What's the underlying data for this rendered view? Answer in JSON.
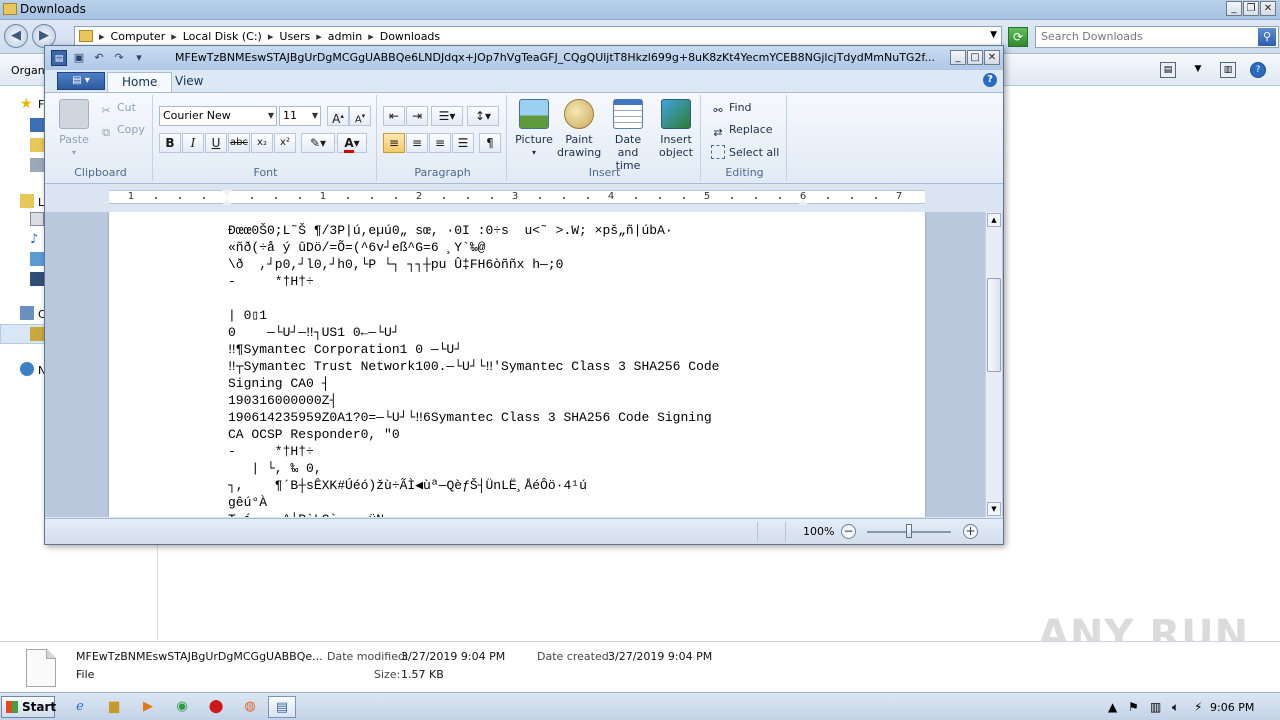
{
  "explorer": {
    "title": "Downloads",
    "breadcrumbs": [
      "Computer",
      "Local Disk (C:)",
      "Users",
      "admin",
      "Downloads"
    ],
    "search_placeholder": "Search Downloads",
    "organize_label": "Organi",
    "nav_letters": [
      "F",
      "L",
      "C",
      "N"
    ],
    "details": {
      "file_name": "MFEwTzBNMEswSTAJBgUrDgMCGgUABBQe...",
      "file_type": "File",
      "modified_label": "Date modified:",
      "modified_value": "3/27/2019 9:04 PM",
      "created_label": "Date created:",
      "created_value": "3/27/2019 9:04 PM",
      "size_label": "Size:",
      "size_value": "1.57 KB"
    }
  },
  "wordpad": {
    "title": "MFEwTzBNMEswSTAJBgUrDgMCGgUABBQe6LNDJdqx+JOp7hVgTeaGFJ_CQgQUljtT8Hkzl699g+8uK8zKt4YecmYCEB8NGjlcjTdydMmNuTG2f...",
    "tabs": {
      "home": "Home",
      "view": "View"
    },
    "groups": {
      "clipboard": "Clipboard",
      "font": "Font",
      "paragraph": "Paragraph",
      "insert": "Insert",
      "editing": "Editing"
    },
    "clipboard": {
      "paste": "Paste",
      "cut": "Cut",
      "copy": "Copy"
    },
    "font": {
      "family": "Courier New",
      "size": "11"
    },
    "insert": {
      "picture": "Picture",
      "paint_line1": "Paint",
      "paint_line2": "drawing",
      "date_line1": "Date and",
      "date_line2": "time",
      "object_line1": "Insert",
      "object_line2": "object"
    },
    "editing": {
      "find": "Find",
      "replace": "Replace",
      "select_all": "Select all"
    },
    "ruler_numbers": [
      "1",
      "1",
      "2",
      "3",
      "4",
      "5",
      "6",
      "7"
    ],
    "document_lines": [
      "Ðœœ0Š0;L˜Š ¶/3P|ú,eµú0„ sœ, ·0I :0÷s  u<˜ >.W; ×pš„ñ|úbA·",
      "«ñð(÷å ý ûDö/=Õ=(^6v┘eß^G=6 ¸Y`‰@",
      "\\ð  ,┘p0,┘l0,┘h0,└P └┐ ┐┐┼pu Û‡FH6òññx h—;0",
      "-     *†H†÷",
      "",
      "| 0▯1",
      "0    —└U┘—‼┐US1 0←—└U┘",
      "‼¶Symantec Corporation1 0 —└U┘",
      "‼┬Symantec Trust Network100.—└U┘└‼'Symantec Class 3 SHA256 Code",
      "Signing CA0 ┤",
      "190316000000Z┤",
      "190614235959Z0A1?0=—└U┘└‼6Symantec Class 3 SHA256 Code Signing",
      "CA OCSP Responder0, \"0",
      "-     *†H†÷",
      "   | └, ‰ 0,",
      "┐,    ¶´B┼sÊXK#Úéó)žù÷ÃÌ◀ùª—QèƒŠ┤ÜnLË¸ÅéÔö·4¹ú",
      "gêú°À",
      "T í~= ·^┤P`LC`·  ·üN"
    ],
    "zoom": "100%"
  },
  "taskbar": {
    "start_label": "Start",
    "clock": "9:06 PM"
  },
  "watermark": "ANY RUN"
}
